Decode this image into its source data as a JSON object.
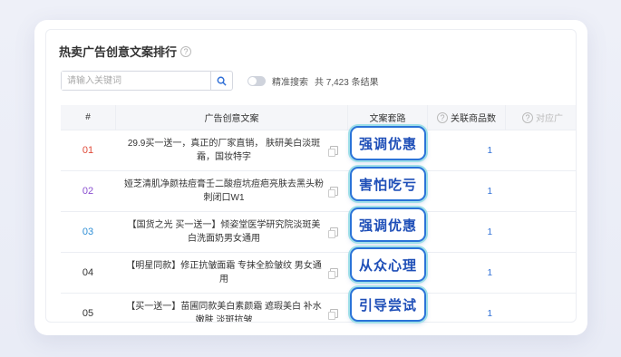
{
  "title": "热卖广告创意文案排行",
  "search": {
    "placeholder": "请输入关键词"
  },
  "precise_label": "精准搜索",
  "result_count": "共 7,423 条结果",
  "columns": {
    "num": "#",
    "ad": "广告创意文案",
    "route": "文案套路",
    "count": "关联商品数",
    "extra": "对应广"
  },
  "rows": [
    {
      "num": "01",
      "num_color": "#e04b3a",
      "text": "29.9买一送一，真正的厂家直销， 肤研美白淡斑霜，国妆特字",
      "route": "强调优惠",
      "count": "1"
    },
    {
      "num": "02",
      "num_color": "#8a4fd0",
      "text": "娅芝清肌净颜祛痘膏壬二酸痘坑痘疤亮肤去黑头粉刺闭口W1",
      "route": "害怕吃亏",
      "count": "1"
    },
    {
      "num": "03",
      "num_color": "#2f8fd6",
      "text": "【国货之光 买一送一】倾姿堂医学研究院淡斑美白洗面奶男女通用",
      "route": "强调优惠",
      "count": "1"
    },
    {
      "num": "04",
      "num_color": "#333333",
      "text": "【明星同款】修正抗皱面霜 专抹全脸皱纹 男女通用",
      "route": "从众心理",
      "count": "1"
    },
    {
      "num": "05",
      "num_color": "#333333",
      "text": "【买一送一】苗圃同款美白素颜霜 遮瑕美白 补水嫩肤 淡斑抗皱",
      "route": "引导尝试",
      "count": "1"
    }
  ]
}
